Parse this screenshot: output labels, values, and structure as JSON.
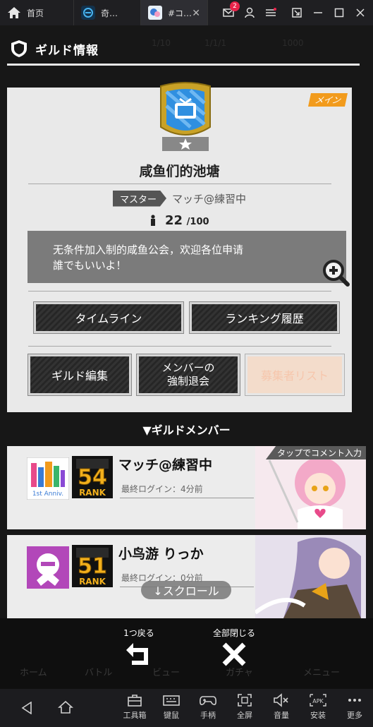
{
  "browser": {
    "tabs": [
      {
        "label": "首页",
        "icon": "home-icon"
      },
      {
        "label": "奇…",
        "icon": "app-icon"
      },
      {
        "label": "#コ…",
        "icon": "game-icon",
        "active": true
      }
    ],
    "mail_badge": "2"
  },
  "game": {
    "header_title": "ギルド情報",
    "bg_texts": [
      "1/10",
      "1/1/1",
      "1000"
    ],
    "guild": {
      "main_tag": "メイン",
      "name": "咸鱼们的池塘",
      "master_label": "マスター",
      "master_name": "マッチ@練習中",
      "member_current": "22",
      "member_max": "/100",
      "description_line1": "无条件加入制的咸鱼公会，欢迎各位申请",
      "description_line2": "誰でもいいよ！",
      "buttons": {
        "timeline": "タイムライン",
        "ranking_history": "ランキング履歴",
        "guild_edit": "ギルド編集",
        "kick_line1": "メンバーの",
        "kick_line2": "強制退会",
        "recruit_list": "募集者リスト"
      }
    },
    "members_heading": "▼ギルドメンバー",
    "members": [
      {
        "name": "マッチ@練習中",
        "rank": "54",
        "rank_label": "RANK",
        "last_login": "最終ログイン：4分前",
        "comment_tag": "タップでコメント入力",
        "avatar_text": "1st Anniv."
      },
      {
        "name": "小鸟游 りっか",
        "rank": "51",
        "rank_label": "RANK",
        "last_login": "最終ログイン：0分前"
      }
    ],
    "scroll_hint": "↓スクロール",
    "overlay": {
      "back_label": "1つ戻る",
      "close_all_label": "全部閉じる"
    },
    "dim_nav": [
      "ホーム",
      "バトル",
      "ビュー",
      "ガチャ",
      "メニュー"
    ]
  },
  "emulator_toolbar": {
    "items": [
      {
        "label": "工具箱",
        "icon": "toolbox-icon"
      },
      {
        "label": "键鼠",
        "icon": "keyboard-icon"
      },
      {
        "label": "手柄",
        "icon": "gamepad-icon"
      },
      {
        "label": "全屏",
        "icon": "fullscreen-icon"
      },
      {
        "label": "音量",
        "icon": "volume-icon"
      },
      {
        "label": "安装",
        "icon": "apk-icon"
      },
      {
        "label": "更多",
        "icon": "more-icon"
      }
    ]
  },
  "colors": {
    "accent_orange": "#f29b1c",
    "emblem_gold": "#c9a227",
    "emblem_blue": "#2f8fe0",
    "badge_red": "#e8234a"
  }
}
